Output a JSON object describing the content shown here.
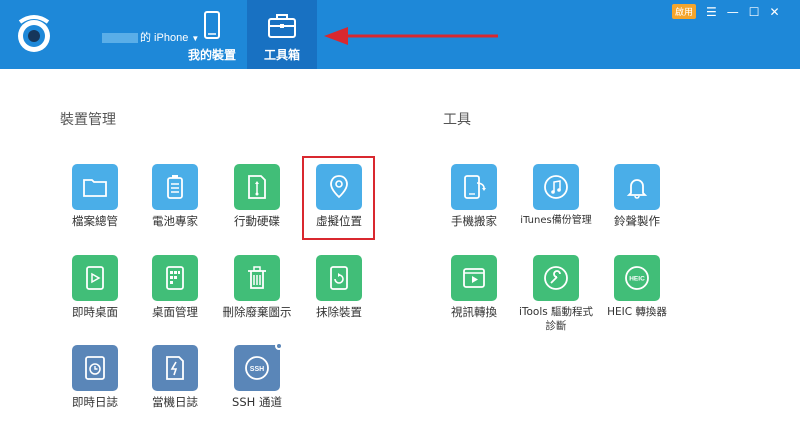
{
  "header": {
    "device_suffix": "的 iPhone",
    "tabs": [
      {
        "label": "我的裝置",
        "icon": "phone-icon"
      },
      {
        "label": "工具箱",
        "icon": "toolbox-icon"
      }
    ],
    "vip_label": "啟用"
  },
  "sections": {
    "device_title": "裝置管理",
    "tools_title": "工具"
  },
  "device_tools": [
    {
      "label": "檔案總管",
      "icon": "folder-icon",
      "color": "#4aaee8"
    },
    {
      "label": "電池專家",
      "icon": "battery-icon",
      "color": "#4aaee8"
    },
    {
      "label": "行動硬碟",
      "icon": "usb-drive-icon",
      "color": "#41be78"
    },
    {
      "label": "虛擬位置",
      "icon": "location-pin-icon",
      "color": "#4aaee8"
    },
    {
      "label": "即時桌面",
      "icon": "play-screen-icon",
      "color": "#41be78"
    },
    {
      "label": "桌面管理",
      "icon": "grid-icon",
      "color": "#41be78"
    },
    {
      "label": "刪除廢棄圖示",
      "icon": "trash-icon",
      "color": "#41be78"
    },
    {
      "label": "抹除裝置",
      "icon": "erase-device-icon",
      "color": "#41be78"
    },
    {
      "label": "即時日誌",
      "icon": "clock-log-icon",
      "color": "#5a86b8"
    },
    {
      "label": "當機日誌",
      "icon": "crash-log-icon",
      "color": "#5a86b8"
    },
    {
      "label": "SSH 通道",
      "icon": "ssh-icon",
      "color": "#5a86b8"
    }
  ],
  "other_tools": [
    {
      "label": "手機搬家",
      "icon": "phone-transfer-icon",
      "color": "#4aaee8"
    },
    {
      "label": "iTunes備份管理",
      "icon": "music-backup-icon",
      "color": "#4aaee8"
    },
    {
      "label": "鈴聲製作",
      "icon": "bell-icon",
      "color": "#4aaee8"
    },
    {
      "label": "視訊轉換",
      "icon": "video-icon",
      "color": "#41be78"
    },
    {
      "label": "iTools 驅動程式診斷",
      "icon": "wrench-icon",
      "color": "#41be78"
    },
    {
      "label": "HEIC 轉換器",
      "icon": "heic-icon",
      "color": "#41be78"
    }
  ]
}
